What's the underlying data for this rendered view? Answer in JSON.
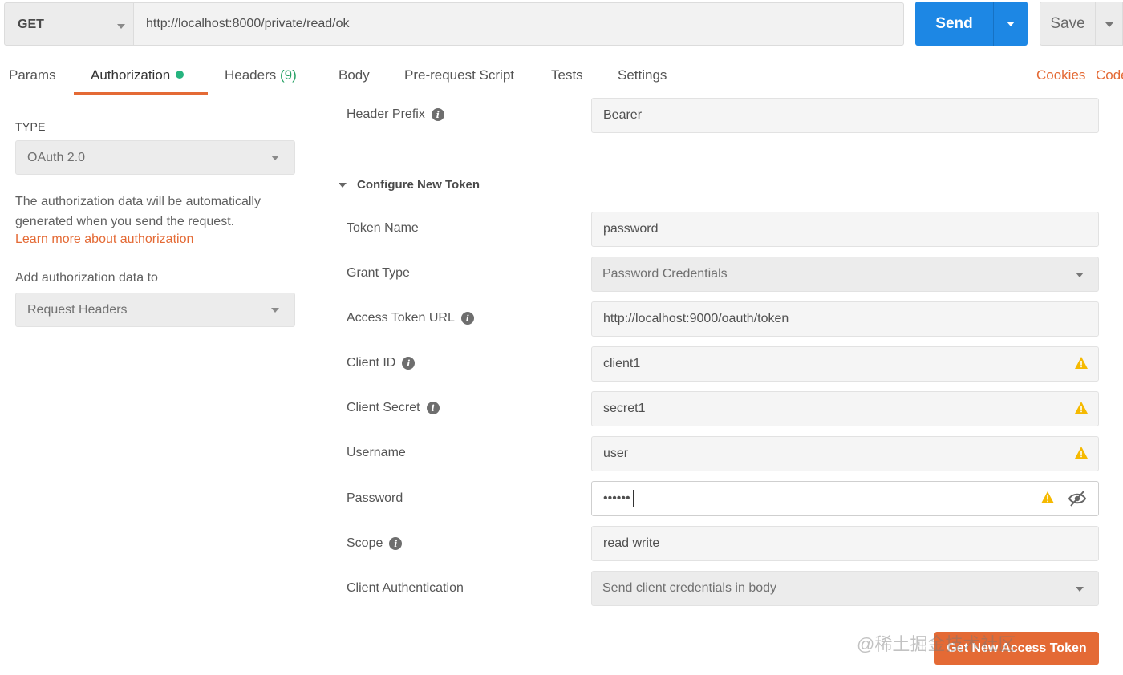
{
  "request": {
    "method": "GET",
    "url": "http://localhost:8000/private/read/ok",
    "send_label": "Send",
    "save_label": "Save"
  },
  "tabs": [
    {
      "label": "Params"
    },
    {
      "label": "Authorization",
      "active": true
    },
    {
      "label": "Headers",
      "count": "(9)"
    },
    {
      "label": "Body"
    },
    {
      "label": "Pre-request Script"
    },
    {
      "label": "Tests"
    },
    {
      "label": "Settings"
    }
  ],
  "tab_links": {
    "cookies": "Cookies",
    "code": "Code"
  },
  "left": {
    "type_label": "TYPE",
    "type_value": "OAuth 2.0",
    "description": "The authorization data will be automatically generated when you send the request.",
    "learn_more": "Learn more about authorization",
    "add_to_label": "Add authorization data to",
    "add_to_value": "Request Headers"
  },
  "form": {
    "header_prefix": {
      "label": "Header Prefix",
      "value": "Bearer"
    },
    "section_title": "Configure New Token",
    "token_name": {
      "label": "Token Name",
      "value": "password"
    },
    "grant_type": {
      "label": "Grant Type",
      "value": "Password Credentials"
    },
    "access_token_url": {
      "label": "Access Token URL",
      "value": "http://localhost:9000/oauth/token"
    },
    "client_id": {
      "label": "Client ID",
      "value": "client1"
    },
    "client_secret": {
      "label": "Client Secret",
      "value": "secret1"
    },
    "username": {
      "label": "Username",
      "value": "user"
    },
    "password": {
      "label": "Password",
      "value": "••••••"
    },
    "scope": {
      "label": "Scope",
      "value": "read write"
    },
    "client_auth": {
      "label": "Client Authentication",
      "value": "Send client credentials in body"
    },
    "get_token_label": "Get New Access Token"
  },
  "watermark": "@稀土掘金技术社区",
  "colors": {
    "accent": "#e46a35",
    "send_blue": "#1d87e4",
    "warning": "#f5b900",
    "active_dot": "#26b47f"
  },
  "icons": {
    "info": "info-icon",
    "warning": "warning-icon",
    "eye": "eye-slash-icon",
    "caret": "chevron-down-icon"
  }
}
